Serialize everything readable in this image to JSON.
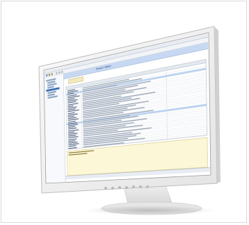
{
  "window": {
    "app_title": "",
    "panel_title": "Report / Editor"
  },
  "colors": {
    "bezel": "#f3f3f3",
    "accent": "#3a6fb5",
    "header_band": "#c7d9f2",
    "note_background": "#fcf7d7"
  },
  "monitor": {
    "buttons": [
      "ctrl-1",
      "ctrl-2",
      "ctrl-3",
      "ctrl-4",
      "ctrl-5",
      "ctrl-6",
      "power"
    ]
  }
}
